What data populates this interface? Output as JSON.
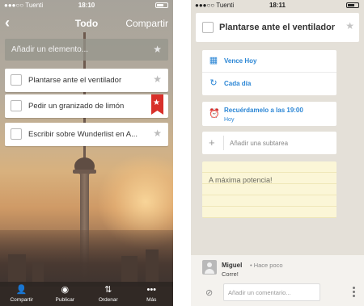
{
  "left": {
    "status": {
      "carrier": "●●●○○ Tuenti",
      "time": "18:10"
    },
    "nav": {
      "back": "‹",
      "title": "Todo",
      "share": "Compartir"
    },
    "add_placeholder": "Añadir un elemento...",
    "star_glyph": "★",
    "tasks": [
      {
        "label": "Plantarse ante el ventilador",
        "starred": false
      },
      {
        "label": "Pedir un granizado de limón",
        "starred": true
      },
      {
        "label": "Escribir sobre Wunderlist en A...",
        "starred": false
      }
    ],
    "tabs": [
      {
        "icon": "add-person-icon",
        "glyph": "👤",
        "label": "Compartir"
      },
      {
        "icon": "globe-icon",
        "glyph": "◉",
        "label": "Publicar"
      },
      {
        "icon": "sort-icon",
        "glyph": "⇅",
        "label": "Ordenar"
      },
      {
        "icon": "more-icon",
        "glyph": "•••",
        "label": "Más"
      }
    ]
  },
  "right": {
    "status": {
      "carrier": "●●●○○ Tuenti",
      "time": "18:11"
    },
    "task_title": "Plantarse ante el ventilador",
    "due": {
      "icon": "calendar-icon",
      "glyph": "▦",
      "label": "Vence Hoy"
    },
    "repeat": {
      "icon": "repeat-icon",
      "glyph": "↻",
      "label": "Cada día"
    },
    "reminder": {
      "icon": "alarm-icon",
      "glyph": "⏰",
      "label": "Recuérdamelo a las 19:00",
      "sub": "Hoy"
    },
    "subtask_placeholder": "Añadir una subtarea",
    "subtask_plus": "+",
    "note": "A máxima potencia!",
    "comment": {
      "author": "Miguel",
      "time": "• Hace poco",
      "text": "Corre!"
    },
    "comment_placeholder": "Añadir un comentario...",
    "clip_glyph": "⊘"
  },
  "colors": {
    "accent": "#2b86d5",
    "ribbon": "#d8302a",
    "note_bg": "#fbf6d7"
  }
}
